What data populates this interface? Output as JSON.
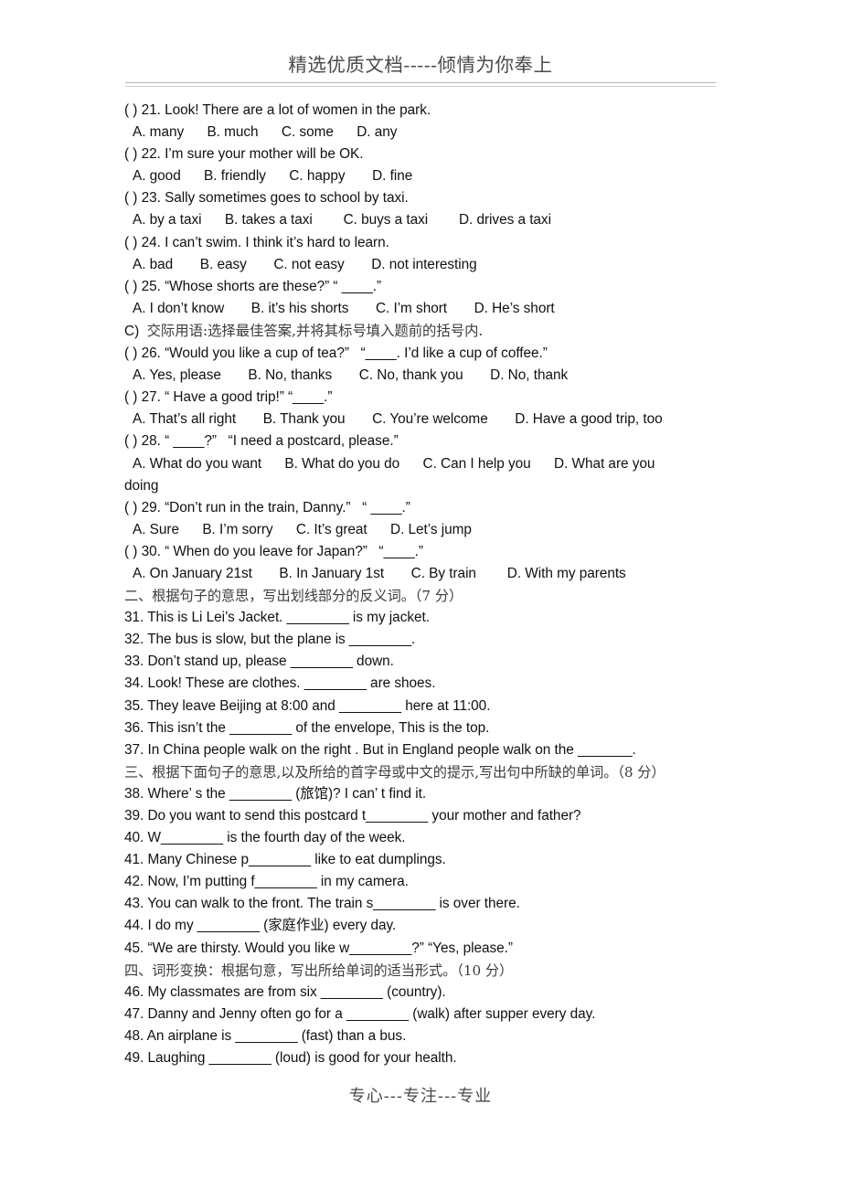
{
  "header": {
    "title": "精选优质文档-----倾情为你奉上"
  },
  "footer": {
    "text": "专心---专注---专业"
  },
  "lines": [
    {
      "kind": "q",
      "text": "( ) 21. Look! There are a lot of women in the park."
    },
    {
      "kind": "opts",
      "text": "A. many      B. much      C. some      D. any"
    },
    {
      "kind": "q",
      "text": "( ) 22. I’m sure your mother will be OK."
    },
    {
      "kind": "opts",
      "text": "A. good      B. friendly      C. happy       D. fine"
    },
    {
      "kind": "q",
      "text": "( ) 23. Sally sometimes goes to school by taxi."
    },
    {
      "kind": "opts",
      "text": "A. by a taxi      B. takes a taxi        C. buys a taxi        D. drives a taxi"
    },
    {
      "kind": "q",
      "text": "( ) 24. I can’t swim. I think it’s hard to learn."
    },
    {
      "kind": "opts",
      "text": "A. bad       B. easy       C. not easy       D. not interesting"
    },
    {
      "kind": "q",
      "text": "( ) 25. “Whose shorts are these?” “ ____.”"
    },
    {
      "kind": "opts",
      "text": "A. I don’t know       B. it’s his shorts       C. I’m short       D. He’s short"
    },
    {
      "kind": "cn-c",
      "prefix": "C)  ",
      "cn": "交际用语:选择最佳答案,并将其标号填入题前的括号内."
    },
    {
      "kind": "q",
      "text": "( ) 26. “Would you like a cup of tea?”   “____. I’d like a cup of coffee.”"
    },
    {
      "kind": "opts",
      "text": "A. Yes, please       B. No, thanks       C. No, thank you       D. No, thank"
    },
    {
      "kind": "q",
      "text": "( ) 27. “ Have a good trip!” “____.”"
    },
    {
      "kind": "opts",
      "text": "A. That’s all right       B. Thank you       C. You’re welcome       D. Have a good trip, too"
    },
    {
      "kind": "q",
      "text": "( ) 28. “ ____?”   “I need a postcard, please.”"
    },
    {
      "kind": "opts",
      "text": "A. What do you want      B. What do you do      C. Can I help you      D. What are you"
    },
    {
      "kind": "fill",
      "text": "doing"
    },
    {
      "kind": "q",
      "text": "( ) 29. “Don’t run in the train, Danny.”   “ ____.”"
    },
    {
      "kind": "opts",
      "text": "A. Sure      B. I’m sorry      C. It’s great      D. Let’s jump"
    },
    {
      "kind": "q",
      "text": "( ) 30. “ When do you leave for Japan?”   “____.”"
    },
    {
      "kind": "opts",
      "text": "A. On January 21st       B. In January 1st       C. By train        D. With my parents"
    },
    {
      "kind": "cn",
      "text": "二、根据句子的意思，写出划线部分的反义词。（7 分）"
    },
    {
      "kind": "fill",
      "text": "31. This is Li Lei’s Jacket. ________ is my jacket."
    },
    {
      "kind": "fill",
      "text": "32. The bus is slow, but the plane is ________."
    },
    {
      "kind": "fill",
      "text": "33. Don’t stand up, please ________ down."
    },
    {
      "kind": "fill",
      "text": "34. Look! These are clothes. ________ are shoes."
    },
    {
      "kind": "fill",
      "text": "35. They leave Beijing at 8:00 and ________ here at 11:00."
    },
    {
      "kind": "fill",
      "text": "36. This isn’t the ________ of the envelope, This is the top."
    },
    {
      "kind": "fill",
      "text": "37. In China people walk on the right . But in England people walk on the _______."
    },
    {
      "kind": "cn",
      "text": "三、根据下面句子的意思,以及所给的首字母或中文的提示,写出句中所缺的单词。（8 分）"
    },
    {
      "kind": "fill",
      "text": "38. Where’ s the ________ (旅馆)? I can’ t find it."
    },
    {
      "kind": "fill",
      "text": "39. Do you want to send this postcard t________ your mother and father?"
    },
    {
      "kind": "fill",
      "text": "40. W________ is the fourth day of the week."
    },
    {
      "kind": "fill",
      "text": "41. Many Chinese p________ like to eat dumplings."
    },
    {
      "kind": "fill",
      "text": "42. Now, I’m putting f________ in my camera."
    },
    {
      "kind": "fill",
      "text": "43. You can walk to the front. The train s________ is over there."
    },
    {
      "kind": "fill",
      "text": "44. I do my ________ (家庭作业) every day."
    },
    {
      "kind": "fill",
      "text": "45. “We are thirsty. Would you like w________?” “Yes, please.”"
    },
    {
      "kind": "cn",
      "text": "四、词形变换：根据句意，写出所给单词的适当形式。（10 分）"
    },
    {
      "kind": "fill",
      "text": "46. My classmates are from six ________ (country)."
    },
    {
      "kind": "fill",
      "text": "47. Danny and Jenny often go for a ________ (walk) after supper every day."
    },
    {
      "kind": "fill",
      "text": "48. An airplane is ________ (fast) than a bus."
    },
    {
      "kind": "fill",
      "text": "49. Laughing ________ (loud) is good for your health."
    }
  ]
}
